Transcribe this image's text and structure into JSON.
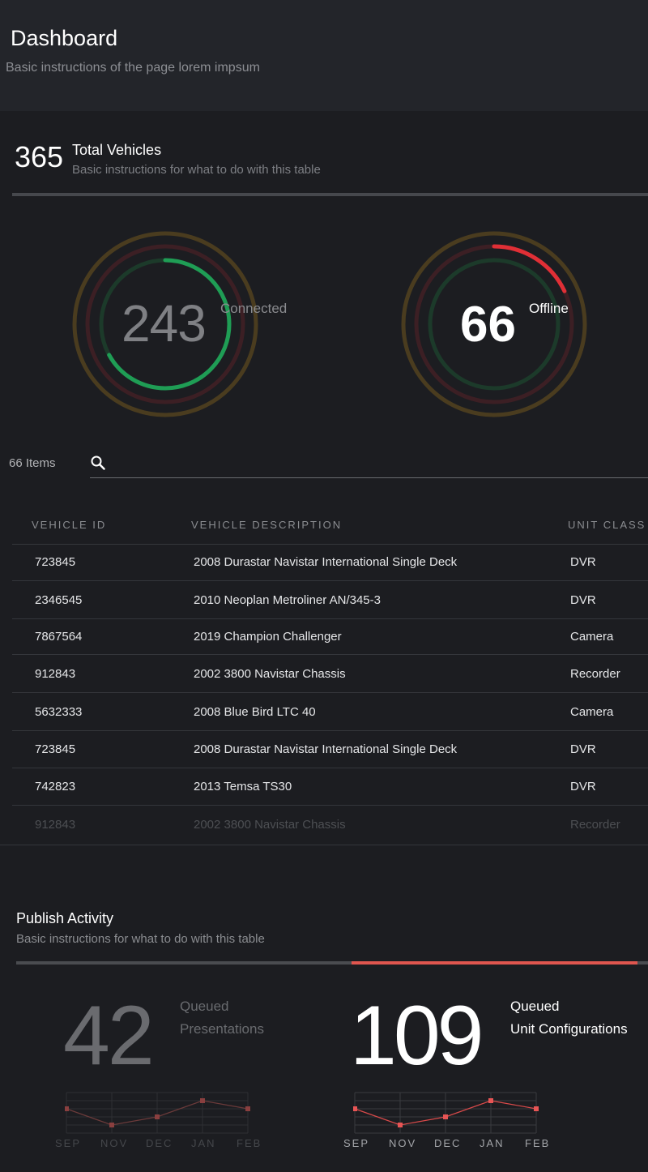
{
  "header": {
    "title": "Dashboard",
    "subtitle": "Basic instructions of the page lorem impsum"
  },
  "vehicles": {
    "total": "365",
    "title": "Total Vehicles",
    "subtitle": "Basic instructions for what to do with this table",
    "connected": {
      "count": "243",
      "label": "Connected",
      "color": "#1f9d55",
      "fraction": 0.67
    },
    "offline": {
      "count": "66",
      "label": "Offline",
      "color": "#e02f36",
      "fraction": 0.18
    }
  },
  "search": {
    "items_label": "66 Items",
    "icon": "search-icon"
  },
  "table": {
    "columns": [
      "VEHICLE ID",
      "VEHICLE DESCRIPTION",
      "UNIT CLASS"
    ],
    "rows": [
      {
        "id": "723845",
        "description": "2008 Durastar Navistar International Single Deck",
        "unit_class": "DVR"
      },
      {
        "id": "2346545",
        "description": "2010 Neoplan Metroliner AN/345-3",
        "unit_class": "DVR"
      },
      {
        "id": "7867564",
        "description": "2019 Champion Challenger",
        "unit_class": "Camera"
      },
      {
        "id": "912843",
        "description": "2002 3800 Navistar Chassis",
        "unit_class": "Recorder"
      },
      {
        "id": "5632333",
        "description": "2008 Blue Bird LTC 40",
        "unit_class": "Camera"
      },
      {
        "id": "723845",
        "description": "2008 Durastar Navistar International Single Deck",
        "unit_class": "DVR"
      },
      {
        "id": "742823",
        "description": "2013 Temsa TS30",
        "unit_class": "DVR"
      },
      {
        "id": "912843",
        "description": "2002 3800 Navistar Chassis",
        "unit_class": "Recorder"
      }
    ]
  },
  "publish": {
    "title": "Publish Activity",
    "subtitle": "Basic instructions for what to do with this table",
    "accent_color": "#e0564f",
    "presentations": {
      "count": "42",
      "label_line1": "Queued",
      "label_line2": "Presentations"
    },
    "configurations": {
      "count": "109",
      "label_line1": "Queued",
      "label_line2": "Unit Configurations"
    },
    "months": [
      "SEP",
      "NOV",
      "DEC",
      "JAN",
      "FEB"
    ]
  },
  "chart_data": [
    {
      "type": "line",
      "title": "",
      "x": [
        "SEP",
        "NOV",
        "DEC",
        "JAN",
        "FEB"
      ],
      "series": [
        {
          "values": [
            3,
            1,
            2,
            4,
            3
          ]
        }
      ]
    },
    {
      "type": "line",
      "title": "",
      "x": [
        "SEP",
        "NOV",
        "DEC",
        "JAN",
        "FEB"
      ],
      "series": [
        {
          "values": [
            3,
            1,
            2,
            4,
            3
          ]
        }
      ]
    }
  ]
}
